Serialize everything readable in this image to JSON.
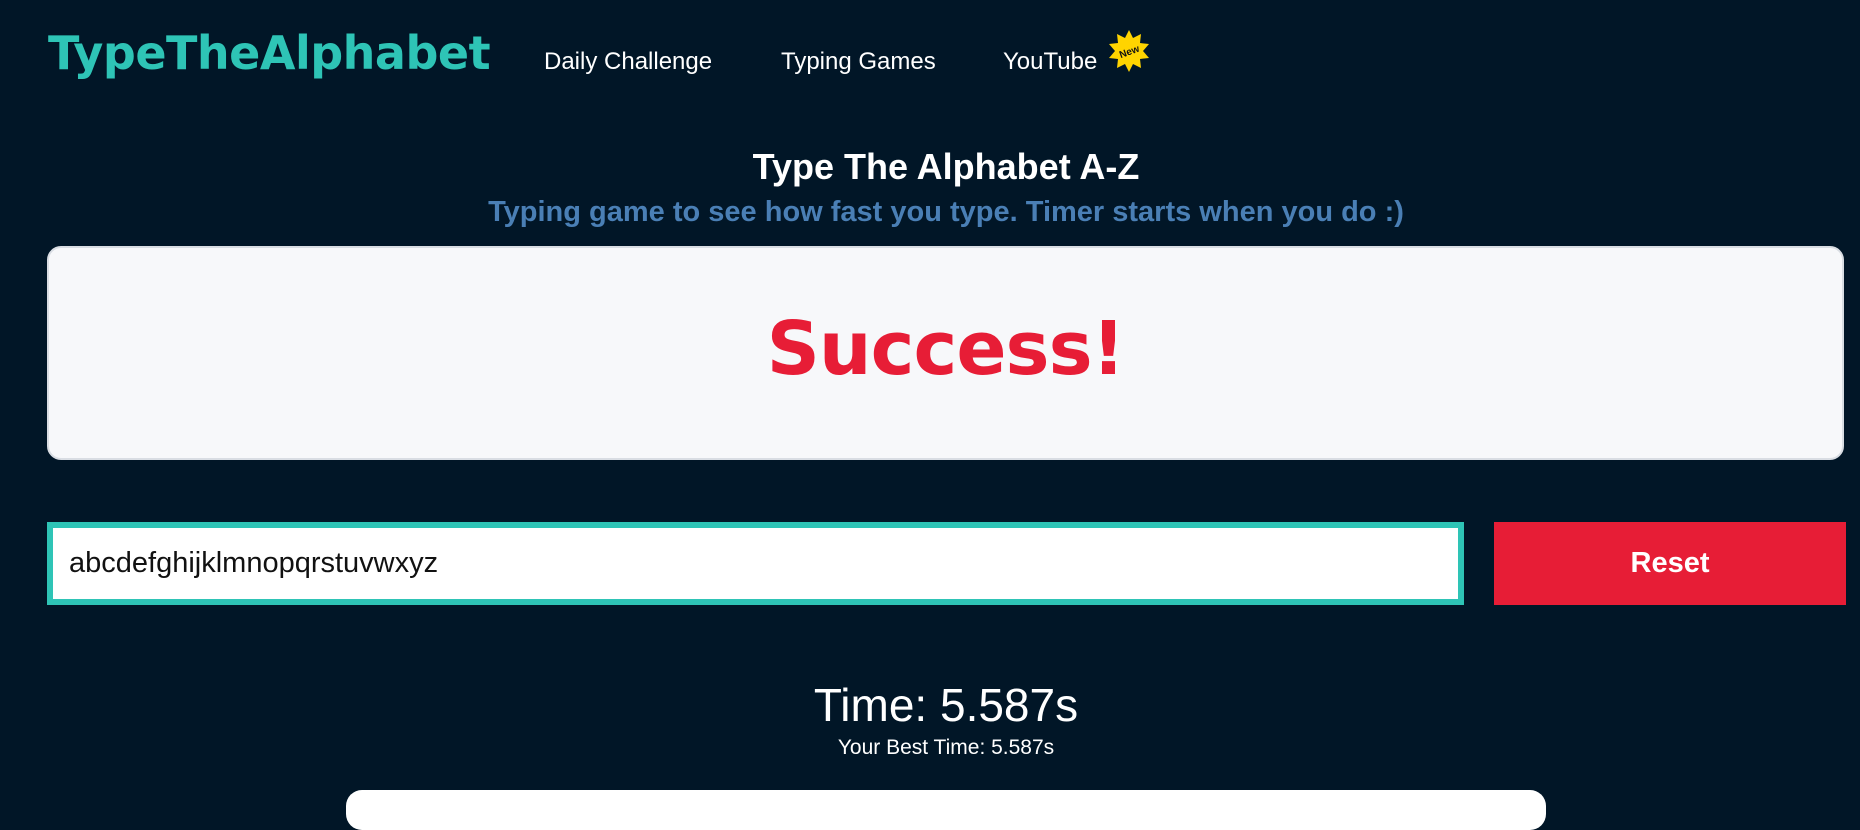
{
  "header": {
    "logo": "TypeTheAlphabet",
    "nav": [
      {
        "label": "Daily Challenge"
      },
      {
        "label": "Typing Games"
      },
      {
        "label": "YouTube"
      }
    ],
    "new_badge": "New"
  },
  "main": {
    "title": "Type The Alphabet A-Z",
    "subtitle": "Typing game to see how fast you type. Timer starts when you do :)",
    "display_text": "Success!",
    "input_value": "abcdefghijklmnopqrstuvwxyz",
    "reset_label": "Reset",
    "time_text": "Time: 5.587s",
    "best_time_text": "Your Best Time: 5.587s"
  },
  "colors": {
    "background": "#011627",
    "accent": "#2ec4b6",
    "danger": "#e71d36",
    "subtitle": "#4a7fb5",
    "badge": "#ffd400"
  }
}
